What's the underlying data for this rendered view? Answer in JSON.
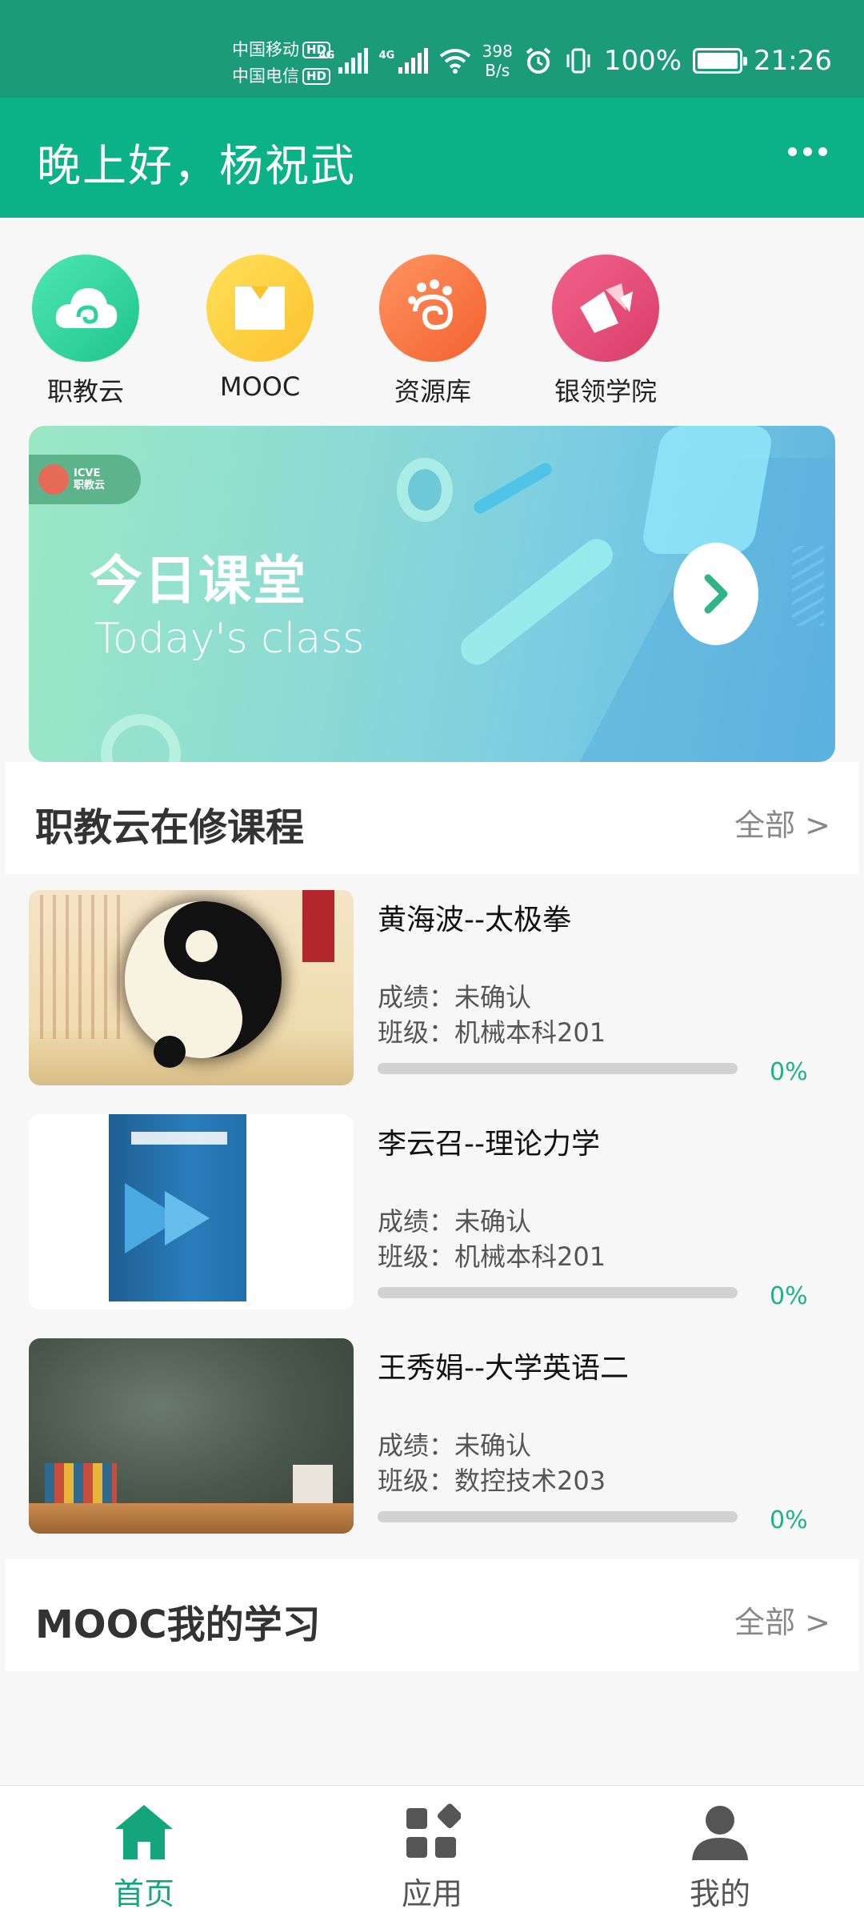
{
  "status_bar": {
    "carrier1": "中国移动",
    "carrier2": "中国电信",
    "hd_badge": "HD",
    "net1": "4G",
    "net2": "4G",
    "speed_value": "398",
    "speed_unit": "B/s",
    "battery": "100%",
    "time": "21:26"
  },
  "header": {
    "greeting": "晚上好，杨祝武"
  },
  "apps": [
    {
      "label": "职教云",
      "color": "#2dd39b"
    },
    {
      "label": "MOOC",
      "color": "#fdd13d"
    },
    {
      "label": "资源库",
      "color": "#f87640"
    },
    {
      "label": "银领学院",
      "color": "#e34e78"
    }
  ],
  "banner": {
    "logo_text_1": "ICVE",
    "logo_text_2": "职教云",
    "title": "今日课堂",
    "subtitle": "Today's class"
  },
  "section_courses": {
    "title": "职教云在修课程",
    "all_link": "全部 >"
  },
  "courses": [
    {
      "name": "黄海波--太极拳",
      "grade": "成绩：未确认",
      "class": "班级：机械本科201",
      "progress": 0,
      "progress_label": "0%"
    },
    {
      "name": "李云召--理论力学",
      "grade": "成绩：未确认",
      "class": "班级：机械本科201",
      "progress": 0,
      "progress_label": "0%"
    },
    {
      "name": "王秀娟--大学英语二",
      "grade": "成绩：未确认",
      "class": "班级：数控技术203",
      "progress": 0,
      "progress_label": "0%"
    }
  ],
  "section_mooc": {
    "title": "MOOC我的学习",
    "all_link": "全部 >"
  },
  "bottom_nav": {
    "home": "首页",
    "apps": "应用",
    "mine": "我的",
    "active_color": "#14a57c",
    "inactive_color": "#555555"
  }
}
